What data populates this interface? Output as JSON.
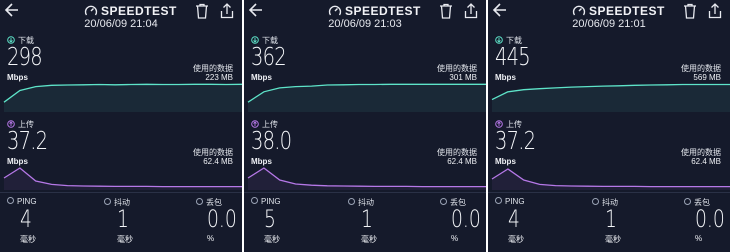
{
  "app": {
    "brand": "SPEEDTEST"
  },
  "colors": {
    "background": "#151a2b",
    "download": "#5ee4c9",
    "upload": "#b678e8"
  },
  "labels": {
    "download": "下载",
    "upload": "上传",
    "unit_speed": "Mbps",
    "used_data": "使用的数据",
    "ping": "PING",
    "jitter": "抖动",
    "loss": "丢包",
    "ms": "毫秒",
    "percent": "%"
  },
  "icons": [
    "back-arrow-icon",
    "speedtest-logo-icon",
    "trash-icon",
    "share-icon",
    "download-icon",
    "upload-icon"
  ],
  "results": [
    {
      "date": "20/06/09 21:04",
      "download": "298",
      "download_used": "223 MB",
      "upload": "37.2",
      "upload_used": "62.4 MB",
      "ping": "4",
      "jitter": "1",
      "loss": "0.0",
      "download_curve": [
        0.3,
        0.75,
        0.9,
        0.95,
        0.96,
        0.97,
        0.98,
        0.97,
        0.98,
        0.99,
        0.98,
        0.98,
        0.99,
        0.99,
        0.98,
        0.99
      ],
      "upload_curve": [
        0.5,
        1.0,
        0.35,
        0.18,
        0.12,
        0.1,
        0.09,
        0.08,
        0.08,
        0.08,
        0.07,
        0.07,
        0.07,
        0.07,
        0.07,
        0.07
      ]
    },
    {
      "date": "20/06/09 21:03",
      "download": "362",
      "download_used": "301 MB",
      "upload": "38.0",
      "upload_used": "62.4 MB",
      "ping": "5",
      "jitter": "1",
      "loss": "0.0",
      "download_curve": [
        0.3,
        0.7,
        0.85,
        0.9,
        0.92,
        0.96,
        0.97,
        0.98,
        0.98,
        0.99,
        0.99,
        0.99,
        0.99,
        0.99,
        0.99,
        0.99
      ],
      "upload_curve": [
        0.5,
        1.0,
        0.4,
        0.2,
        0.14,
        0.11,
        0.1,
        0.09,
        0.08,
        0.08,
        0.08,
        0.07,
        0.07,
        0.07,
        0.07,
        0.07
      ]
    },
    {
      "date": "20/06/09 21:01",
      "download": "445",
      "download_used": "569 MB",
      "upload": "37.2",
      "upload_used": "62.4 MB",
      "ping": "4",
      "jitter": "1",
      "loss": "0.0",
      "download_curve": [
        0.4,
        0.7,
        0.78,
        0.82,
        0.85,
        0.88,
        0.9,
        0.92,
        0.93,
        0.95,
        0.96,
        0.97,
        0.98,
        0.98,
        0.98,
        0.98
      ],
      "upload_curve": [
        0.45,
        0.95,
        0.4,
        0.18,
        0.12,
        0.1,
        0.09,
        0.08,
        0.08,
        0.08,
        0.07,
        0.07,
        0.07,
        0.07,
        0.07,
        0.07
      ]
    }
  ]
}
